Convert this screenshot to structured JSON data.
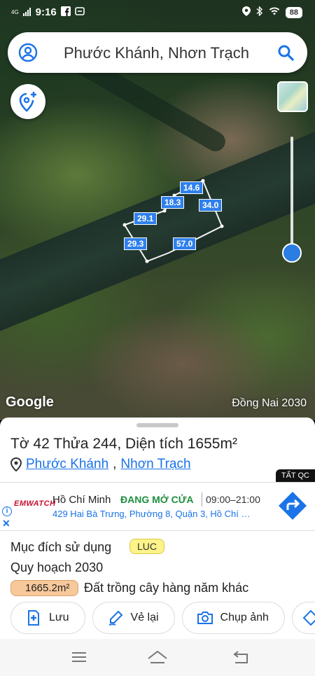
{
  "status_bar": {
    "network": "4G",
    "time": "9:16",
    "battery": "88"
  },
  "search": {
    "query": "Phước Khánh, Nhơn Trạch"
  },
  "map": {
    "plot_lengths": [
      "14.6",
      "18.3",
      "34.0",
      "29.1",
      "29.3",
      "57.0"
    ],
    "watermark": "Google",
    "region_label": "Đồng Nai 2030"
  },
  "parcel": {
    "title": "Tờ 42 Thửa 244, Diện tích 1655m²",
    "ward": "Phước Khánh",
    "separator": ",",
    "district": "Nhơn Trạch",
    "purpose_label": "Mục đích sử dụng",
    "purpose_code": "LUC",
    "plan_label": "Quy hoạch 2030",
    "plan_area": "1665.2m²",
    "plan_land_type": "Đất trồng cây hàng năm khác"
  },
  "ad": {
    "tag": "TẤT QC",
    "brand": "EMWATCH",
    "city": "Hồ Chí Minh",
    "status": "ĐANG MỞ CỬA",
    "hours": "09:00–21:00",
    "address": "429 Hai Bà Trưng, Phường 8, Quận 3, Hồ Chí …",
    "close": "✕",
    "info": "i"
  },
  "actions": [
    {
      "label": "Lưu",
      "icon": "add-bookmark-icon"
    },
    {
      "label": "Vẻ lại",
      "icon": "redraw-icon"
    },
    {
      "label": "Chụp ảnh",
      "icon": "camera-icon"
    }
  ],
  "colors": {
    "accent": "#1a73e8",
    "plot_label": "#2f80ed",
    "status_open": "#1e8e3e",
    "purpose_badge": "#fdf38a",
    "area_badge": "#f7c89a"
  }
}
